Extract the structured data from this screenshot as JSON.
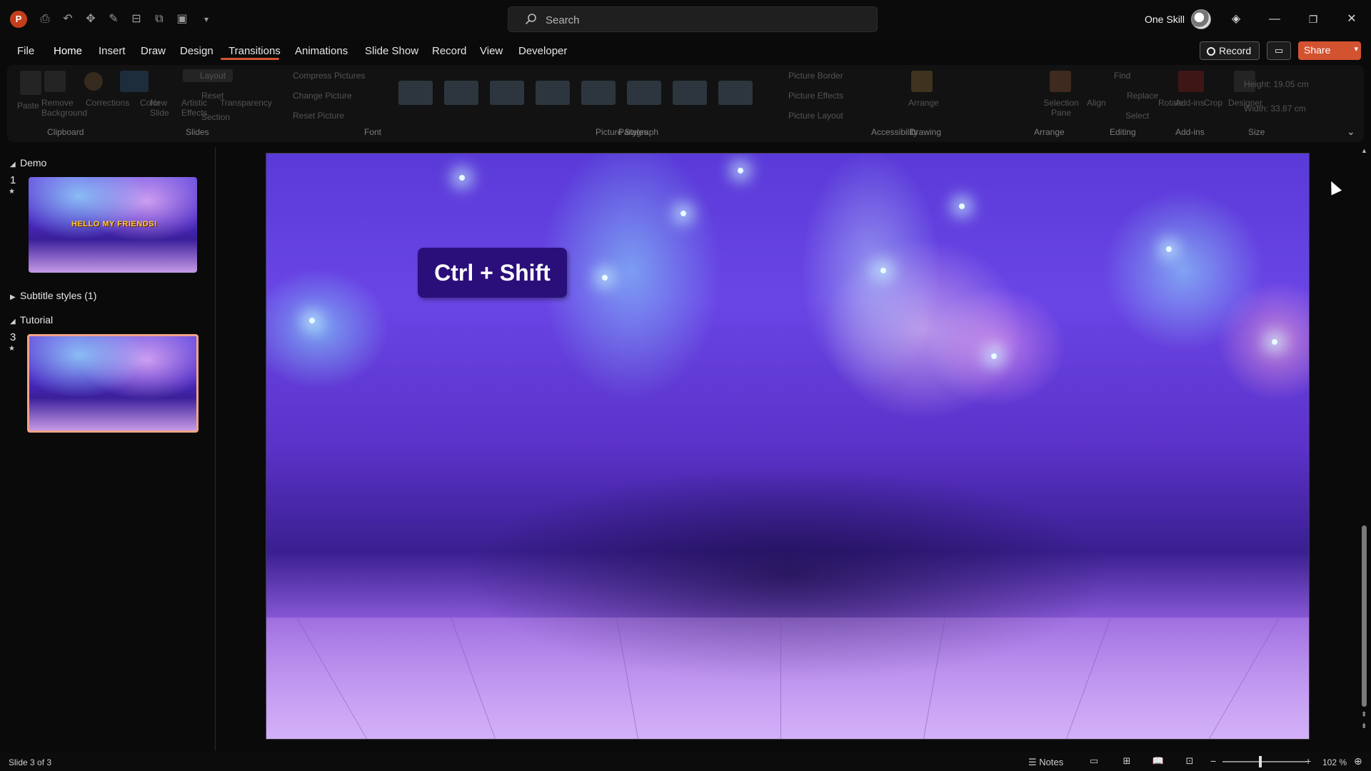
{
  "app": {
    "logo_letter": "P"
  },
  "search": {
    "placeholder": "Search"
  },
  "user": {
    "name": "One Skill"
  },
  "menu": {
    "tabs": [
      "File",
      "Home",
      "Insert",
      "Draw",
      "Design",
      "Transitions",
      "Animations",
      "Slide Show",
      "Record",
      "View",
      "Developer"
    ],
    "active_tab": "Transitions"
  },
  "toolbar": {
    "record_label": "Record",
    "share_label": "Share"
  },
  "ribbon": {
    "labels": [
      "Paste",
      "Remove Background",
      "Corrections",
      "Color",
      "Artistic Effects",
      "New Slide",
      "Layout",
      "Reset",
      "Section",
      "Transparency",
      "Compress Pictures",
      "Change Picture",
      "Reset Picture",
      "Picture Border",
      "Picture Effects",
      "Picture Layout",
      "Arrange",
      "Selection Pane",
      "Align",
      "Find",
      "Replace",
      "Select",
      "Rotate",
      "Crop",
      "Add-ins",
      "Designer",
      "Height: 19.05 cm",
      "Width: 33.87 cm"
    ],
    "groups": [
      "Clipboard",
      "Slides",
      "Font",
      "Picture Styles",
      "Paragraph",
      "Accessibility",
      "Drawing",
      "Arrange",
      "Editing",
      "Add-ins",
      "Size"
    ]
  },
  "slides_panel": {
    "sections": [
      {
        "name": "Demo",
        "slides": [
          {
            "number": "1",
            "title": "HELLO MY FRIENDS!"
          }
        ]
      },
      {
        "name": "Subtitle styles (1)",
        "collapsed": true
      },
      {
        "name": "Tutorial",
        "slides": [
          {
            "number": "3"
          }
        ]
      }
    ],
    "selected_slide": "3"
  },
  "slide": {
    "badge_text": "Ctrl + Shift"
  },
  "status": {
    "slide_counter": "Slide 3 of 3",
    "notes_label": "Notes",
    "zoom": "102 %",
    "zoom_percent": 102
  },
  "colors": {
    "accent": "#d35230",
    "badge": "#2a0f7a",
    "selection": "#f4a489"
  }
}
